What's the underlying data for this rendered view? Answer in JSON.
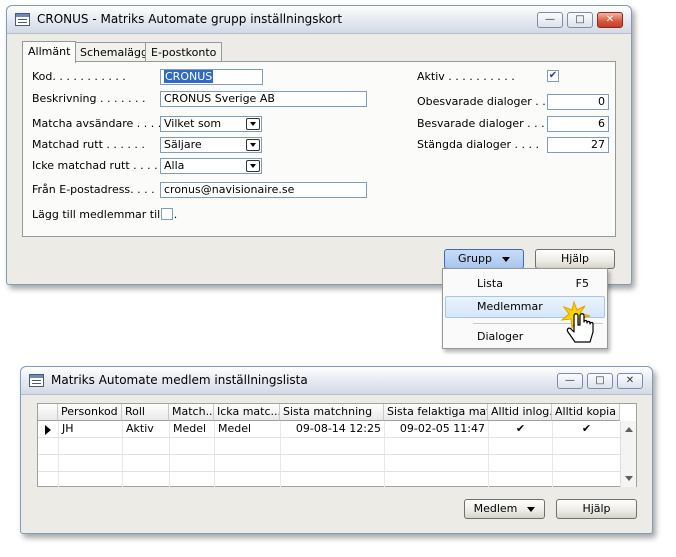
{
  "win1": {
    "title": "CRONUS - Matriks Automate grupp inställningskort",
    "tabs": [
      "Allmänt",
      "Schemalägg",
      "E-postkonto"
    ],
    "fields": {
      "kod_label": "Kod. . . . . . . . . . .",
      "kod_value": "CRONUS",
      "beskr_label": "Beskrivning . . . . . . .",
      "beskr_value": "CRONUS Sverige AB",
      "matcha_label": "Matcha avsändare . . . .",
      "matcha_value": "Vilket som",
      "matchad_label": "Matchad rutt . . . . . .",
      "matchad_value": "Säljare",
      "icke_label": "Icke matchad rutt . . . .",
      "icke_value": "Alla",
      "fran_label": "Från E-postadress. . . .",
      "fran_value": "cronus@navisionaire.se",
      "lagg_label": "Lägg till medlemmar till ...",
      "aktiv_label": "Aktiv . . . . . . . . . .",
      "obes_label": "Obesvarade dialoger . .",
      "obes_value": "0",
      "besv_label": "Besvarade dialoger . . .",
      "besv_value": "6",
      "stang_label": "Stängda dialoger . . . .",
      "stang_value": "27"
    },
    "buttons": {
      "grupp": "Grupp",
      "hjalp": "Hjälp"
    },
    "menu": [
      {
        "label": "Lista",
        "shortcut": "F5"
      },
      {
        "label": "Medlemmar",
        "shortcut": ""
      },
      {
        "label": "Dialoger",
        "shortcut": ""
      }
    ]
  },
  "win2": {
    "title": "Matriks Automate medlem inställningslista",
    "columns": [
      "Personkod",
      "Roll",
      "Match...",
      "Icka matc...",
      "Sista matchning",
      "Sista felaktiga mat...",
      "Alltid inlog...",
      "Alltid kopia"
    ],
    "rows": [
      [
        "JH",
        "Aktiv",
        "Medel",
        "Medel",
        "09-08-14 12:25",
        "09-02-05 11:47",
        "✔",
        "✔"
      ]
    ],
    "buttons": {
      "medlem": "Medlem",
      "hjalp": "Hjälp"
    }
  },
  "colors": {
    "accent": "#316ac5",
    "window_bg": "#ecebe6",
    "border": "#7f9db9"
  }
}
